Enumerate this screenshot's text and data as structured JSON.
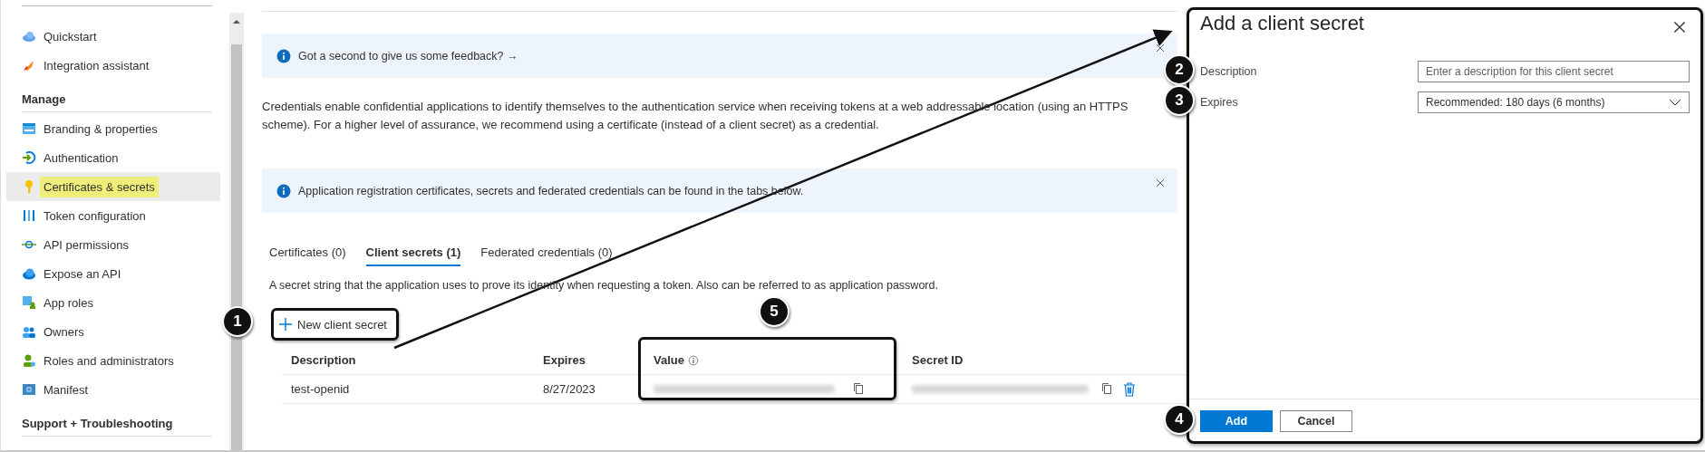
{
  "sidebar": {
    "items": [
      {
        "kind": "link",
        "label": "Quickstart",
        "selected": false
      },
      {
        "kind": "link",
        "label": "Integration assistant",
        "selected": false
      },
      {
        "kind": "heading",
        "label": "Manage"
      },
      {
        "kind": "link",
        "label": "Branding & properties",
        "selected": false
      },
      {
        "kind": "link",
        "label": "Authentication",
        "selected": false
      },
      {
        "kind": "link",
        "label": "Certificates & secrets",
        "selected": true
      },
      {
        "kind": "link",
        "label": "Token configuration",
        "selected": false
      },
      {
        "kind": "link",
        "label": "API permissions",
        "selected": false
      },
      {
        "kind": "link",
        "label": "Expose an API",
        "selected": false
      },
      {
        "kind": "link",
        "label": "App roles",
        "selected": false
      },
      {
        "kind": "link",
        "label": "Owners",
        "selected": false
      },
      {
        "kind": "link",
        "label": "Roles and administrators",
        "selected": false
      },
      {
        "kind": "link",
        "label": "Manifest",
        "selected": false
      },
      {
        "kind": "heading",
        "label": "Support + Troubleshooting"
      }
    ]
  },
  "main": {
    "feedback_banner": {
      "text": "Got a second to give us some feedback? →"
    },
    "intro": "Credentials enable confidential applications to identify themselves to the authentication service when receiving tokens at a web addressable location (using an HTTPS scheme). For a higher level of assurance, we recommend using a certificate (instead of a client secret) as a credential.",
    "info_banner": {
      "text": "Application registration certificates, secrets and federated credentials can be found in the tabs below."
    },
    "tabs": [
      {
        "label": "Certificates (0)",
        "selected": false
      },
      {
        "label": "Client secrets (1)",
        "selected": true
      },
      {
        "label": "Federated credentials (0)",
        "selected": false
      }
    ],
    "tab_description": "A secret string that the application uses to prove its identity when requesting a token. Also can be referred to as application password.",
    "new_button": {
      "label": "New client secret",
      "callout": "1"
    },
    "table": {
      "columns": [
        {
          "label": "Description"
        },
        {
          "label": "Expires"
        },
        {
          "label": "Value",
          "info": true,
          "callout": "5"
        },
        {
          "label": "Secret ID"
        }
      ],
      "rows": [
        {
          "cells": [
            {
              "kind": "text",
              "text": "test-openid"
            },
            {
              "kind": "text",
              "text": "8/27/2023"
            },
            {
              "kind": "redacted"
            },
            {
              "kind": "redacted"
            }
          ]
        }
      ]
    }
  },
  "panel": {
    "title": "Add a client secret",
    "fields": [
      {
        "kind": "input",
        "label": "Description",
        "placeholder": "Enter a description for this client secret",
        "callout": "2"
      },
      {
        "kind": "select",
        "label": "Expires",
        "value": "Recommended: 180 days (6 months)",
        "callout": "3"
      }
    ],
    "buttons": [
      {
        "kind": "primary",
        "label": "Add",
        "callout": "4"
      },
      {
        "kind": "secondary",
        "label": "Cancel"
      }
    ]
  }
}
